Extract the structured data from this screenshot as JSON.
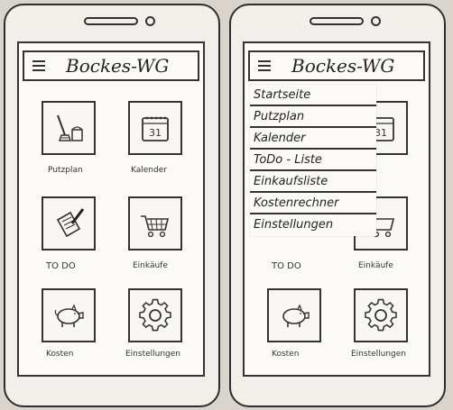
{
  "app": {
    "title": "Bockes-WG"
  },
  "home_tiles": [
    {
      "label": "Putzplan",
      "icon": "broom-bucket-icon"
    },
    {
      "label": "Kalender",
      "icon": "calendar-icon",
      "calendar_day": "31"
    },
    {
      "label": "TO DO",
      "icon": "todo-note-pen-icon"
    },
    {
      "label": "Einkäufe",
      "icon": "shopping-cart-icon"
    },
    {
      "label": "Kosten",
      "icon": "piggy-bank-icon"
    },
    {
      "label": "Einstellungen",
      "icon": "gear-icon"
    }
  ],
  "menu": {
    "items": [
      {
        "label": "Startseite"
      },
      {
        "label": "Putzplan"
      },
      {
        "label": "Kalender"
      },
      {
        "label": "ToDo - Liste"
      },
      {
        "label": "Einkaufsliste"
      },
      {
        "label": "Kostenrechner"
      },
      {
        "label": "Einstellungen"
      }
    ]
  },
  "colors": {
    "ink": "#2d2d2d",
    "paper": "#fbfaf7",
    "background": "#d9d5cc"
  }
}
